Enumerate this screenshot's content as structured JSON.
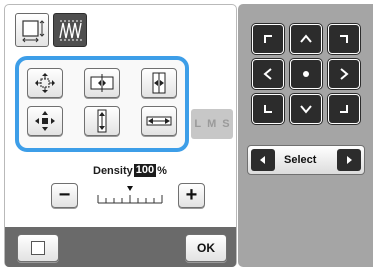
{
  "tabs": [
    {
      "name": "frame-tab",
      "icon": "frame-size-icon",
      "selected": false
    },
    {
      "name": "pattern-tab",
      "icon": "stitch-pattern-icon",
      "selected": true
    }
  ],
  "direction_buttons": [
    {
      "icon": "expand-all-icon"
    },
    {
      "icon": "expand-left-right-icon"
    },
    {
      "icon": "shrink-horizontal-icon"
    },
    {
      "icon": "shrink-all-icon"
    },
    {
      "icon": "expand-vertical-icon"
    },
    {
      "icon": "expand-horizontal-icon"
    }
  ],
  "size_strip": {
    "labels": [
      "L",
      "M",
      "S"
    ]
  },
  "density": {
    "label": "Density",
    "value": "100",
    "unit": "%"
  },
  "density_controls": {
    "minus": "−",
    "plus": "+"
  },
  "footer": {
    "ok_label": "OK"
  },
  "nav_pad": [
    {
      "icon": "corner-top-left-icon"
    },
    {
      "icon": "arrow-up-icon"
    },
    {
      "icon": "corner-top-right-icon"
    },
    {
      "icon": "arrow-left-icon"
    },
    {
      "icon": "center-dot-icon"
    },
    {
      "icon": "arrow-right-icon"
    },
    {
      "icon": "corner-bottom-left-icon"
    },
    {
      "icon": "arrow-down-icon"
    },
    {
      "icon": "corner-bottom-right-icon"
    }
  ],
  "select": {
    "label": "Select"
  },
  "colors": {
    "highlight": "#3d9ee8",
    "panel_gray": "#a5a5a5",
    "dark_button": "#2c2c2c"
  }
}
